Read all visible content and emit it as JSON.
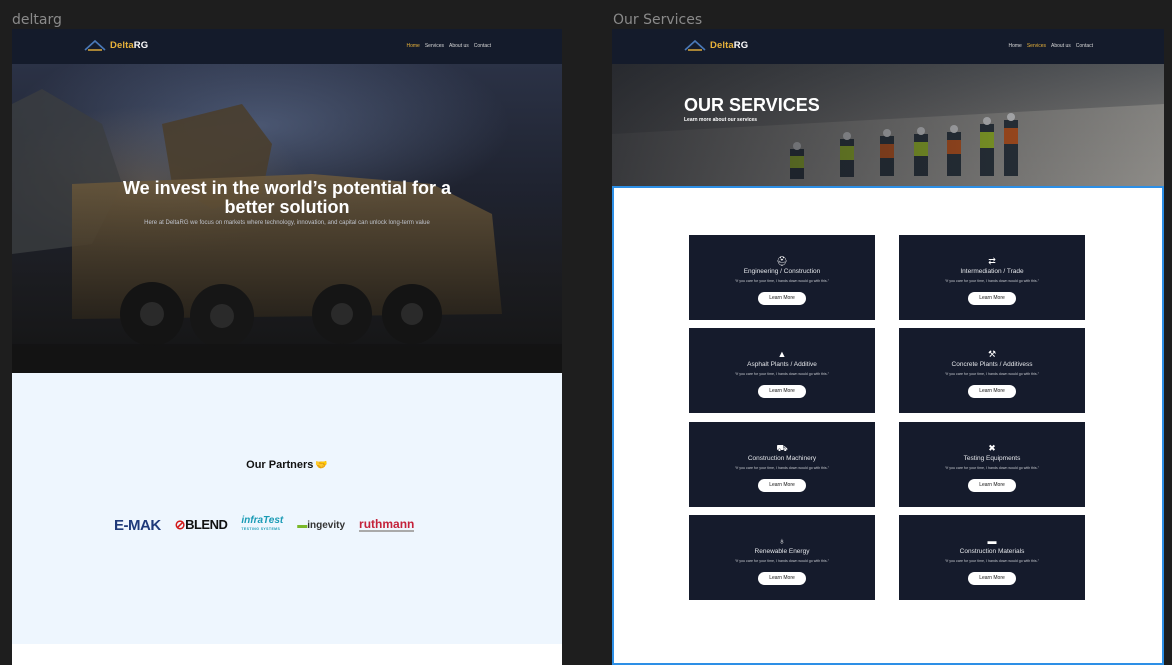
{
  "frames": {
    "home_label": "deltarg",
    "services_label": "Our Services"
  },
  "brand": {
    "name_part1": "Delta",
    "name_part2": "RG",
    "accent_color": "#e8b23a",
    "nav_bg_color": "#141b2b"
  },
  "home": {
    "nav": [
      "Home",
      "Services",
      "About us",
      "Contact"
    ],
    "active_nav": "Home",
    "hero_title": "We invest in the world’s potential for a better solution",
    "hero_subtitle": "Here at DeltaRG we focus on markets where technology, innovation, and capital can unlock long-term value",
    "partners_title": "Our Partners",
    "partners_icon": "handshake-icon",
    "partners": [
      "E-MAK",
      "BLEND",
      "infraTest",
      "ingevity",
      "ruthmann"
    ],
    "partner_subtexts": {
      "infratest": "TESTING SYSTEMS"
    }
  },
  "services": {
    "nav": [
      "Home",
      "Services",
      "About us",
      "Contact"
    ],
    "active_nav": "Services",
    "hero_title": "OUR SERVICES",
    "hero_subtitle": "Learn more about our services",
    "card_button": "Learn More",
    "card_description": "“If you care for your time, I hands down would go with this.”",
    "cards": [
      {
        "title": "Engineering / Construction",
        "icon": "helmet-icon",
        "glyph": "⛑"
      },
      {
        "title": "Intermediation / Trade",
        "icon": "exchange-icon",
        "glyph": "⇄"
      },
      {
        "title": "Asphalt Plants / Additive",
        "icon": "road-icon",
        "glyph": "▲"
      },
      {
        "title": "Concrete Plants / Additivess",
        "icon": "worker-icon",
        "glyph": "⚒"
      },
      {
        "title": "Construction Machinery",
        "icon": "excavator-icon",
        "glyph": "⛟"
      },
      {
        "title": "Testing Equipments",
        "icon": "tools-icon",
        "glyph": "✖"
      },
      {
        "title": "Renewable Energy",
        "icon": "lightbulb-icon",
        "glyph": "♁"
      },
      {
        "title": "Construction Materials",
        "icon": "toolbox-icon",
        "glyph": "▬"
      }
    ]
  },
  "selection_color": "#2d8fe6"
}
